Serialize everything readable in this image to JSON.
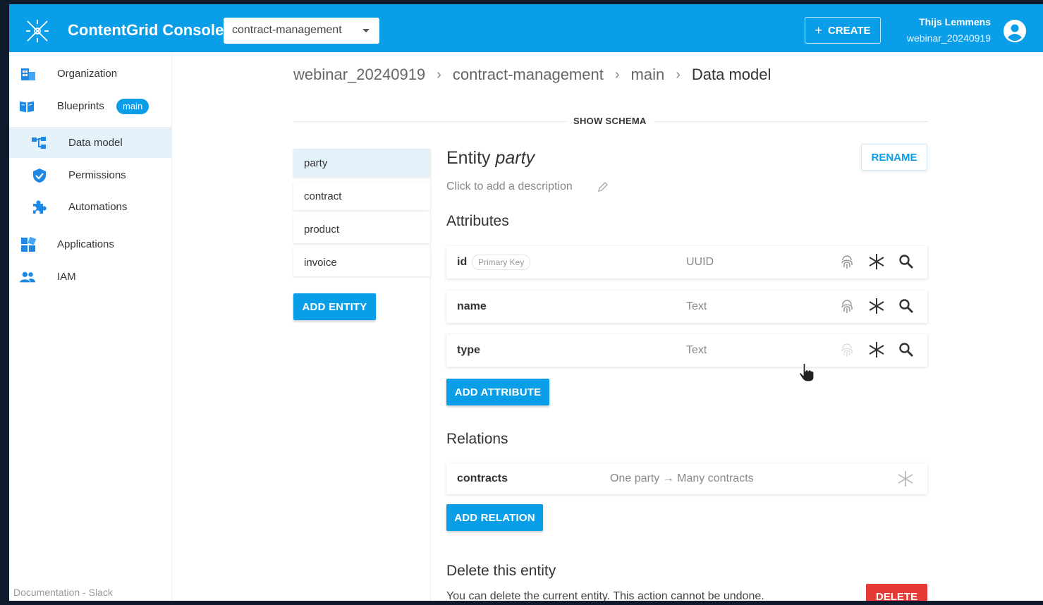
{
  "header": {
    "app_title": "ContentGrid Console",
    "project_selected": "contract-management",
    "create_label": "CREATE",
    "user_name": "Thijs Lemmens",
    "user_org": "webinar_20240919",
    "bg_color": "#0a9ee8"
  },
  "sidebar": {
    "items": [
      {
        "label": "Organization",
        "icon": "organization-icon"
      },
      {
        "label": "Blueprints",
        "icon": "blueprints-icon",
        "badge": "main"
      },
      {
        "label": "Data model",
        "icon": "data-model-icon",
        "active": true
      },
      {
        "label": "Permissions",
        "icon": "shield-icon"
      },
      {
        "label": "Automations",
        "icon": "puzzle-icon"
      },
      {
        "label": "Applications",
        "icon": "applications-icon"
      },
      {
        "label": "IAM",
        "icon": "people-icon"
      }
    ],
    "footer": "Documentation - Slack"
  },
  "breadcrumb": [
    "webinar_20240919",
    "contract-management",
    "main",
    "Data model"
  ],
  "show_schema_label": "SHOW SCHEMA",
  "entities": [
    "party",
    "contract",
    "product",
    "invoice"
  ],
  "add_entity_label": "ADD ENTITY",
  "entity": {
    "title_prefix": "Entity",
    "name": "party",
    "rename_label": "RENAME",
    "description_placeholder": "Click to add a description"
  },
  "attributes": {
    "heading": "Attributes",
    "rows": [
      {
        "name": "id",
        "badge": "Primary Key",
        "type": "UUID"
      },
      {
        "name": "name",
        "type": "Text"
      },
      {
        "name": "type",
        "type": "Text"
      }
    ],
    "add_label": "ADD ATTRIBUTE"
  },
  "relations": {
    "heading": "Relations",
    "rows": [
      {
        "name": "contracts",
        "description": "One party → Many contracts"
      }
    ],
    "add_label": "ADD RELATION"
  },
  "delete_section": {
    "heading": "Delete this entity",
    "text": "You can delete the current entity. This action cannot be undone.",
    "button_label": "DELETE",
    "button_color": "#e53935"
  }
}
